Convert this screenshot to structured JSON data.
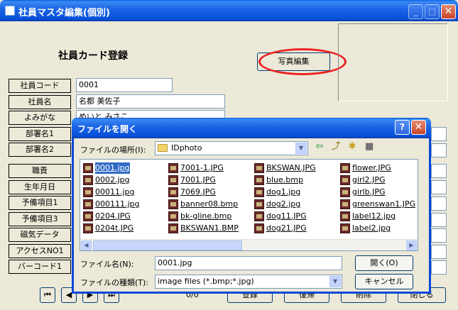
{
  "window": {
    "title": "社員マスタ編集(個別)",
    "minimize_glyph": "_",
    "maximize_glyph": "□",
    "close_glyph": "✕"
  },
  "form": {
    "heading": "社員カード登録",
    "photo_button": "写真編集",
    "fields": [
      {
        "label": "社員コード",
        "value": "0001"
      },
      {
        "label": "社員名",
        "value": "名都 美佐子"
      },
      {
        "label": "よみがな",
        "value": "めいと みさこ"
      },
      {
        "label": "部署名1",
        "value": ""
      },
      {
        "label": "部署名2",
        "value": ""
      },
      {
        "label": "職責",
        "value": ""
      },
      {
        "label": "生年月日",
        "value": ""
      },
      {
        "label": "予備項目1",
        "value": ""
      },
      {
        "label": "予備項目3",
        "value": ""
      },
      {
        "label": "磁気データ",
        "value": ""
      },
      {
        "label": "アクセスNO1",
        "value": ""
      },
      {
        "label": "バーコード1",
        "value": ""
      }
    ],
    "nav_buttons": [
      {
        "icon": "first-icon",
        "glyph": "⏮"
      },
      {
        "icon": "prev-icon",
        "glyph": "◀"
      },
      {
        "icon": "next-icon",
        "glyph": "▶"
      },
      {
        "icon": "last-icon",
        "glyph": "⏭"
      }
    ],
    "record_counter": "0/0",
    "action_buttons": [
      "登録",
      "復帰",
      "削除",
      "閉じる"
    ]
  },
  "dialog": {
    "title": "ファイルを開く",
    "help_glyph": "?",
    "close_glyph": "✕",
    "location_label": "ファイルの場所(I):",
    "location_value": "IDphoto",
    "toolbar_icons": [
      {
        "name": "back-icon",
        "glyph": "⇦"
      },
      {
        "name": "up-folder-icon",
        "glyph": "⤴"
      },
      {
        "name": "new-folder-icon",
        "glyph": "✱"
      },
      {
        "name": "view-menu-icon",
        "glyph": "▦"
      }
    ],
    "files": [
      [
        "0001.jpg",
        "0002.jpg",
        "00011.jpg",
        "000111.jpg",
        "0204.JPG",
        "0204t.JPG"
      ],
      [
        "7001-1.JPG",
        "7001.JPG",
        "7069.JPG",
        "banner08.bmp",
        "bk-gline.bmp",
        "BKSWAN1.BMP"
      ],
      [
        "BKSWAN.JPG",
        "blue.bmp",
        "dog1.jpg",
        "dog2.jpg",
        "dog11.JPG",
        "dog21.JPG"
      ],
      [
        "flower.JPG",
        "girl2.JPG",
        "girlb.JPG",
        "greenswan1.JPG",
        "label12.jpg",
        "label2.jpg"
      ]
    ],
    "selected_file": "0001.jpg",
    "filename_label": "ファイル名(N):",
    "filename_value": "0001.jpg",
    "filetype_label": "ファイルの種類(T):",
    "filetype_value": "image files (*.bmp;*.jpg)",
    "open_button": "開く(O)",
    "cancel_button": "キャンセル"
  },
  "colors": {
    "titlebar": "#0850d8",
    "window_bg": "#ece9d8",
    "selection": "#316ac5",
    "highlight_ring": "#ee2222"
  }
}
